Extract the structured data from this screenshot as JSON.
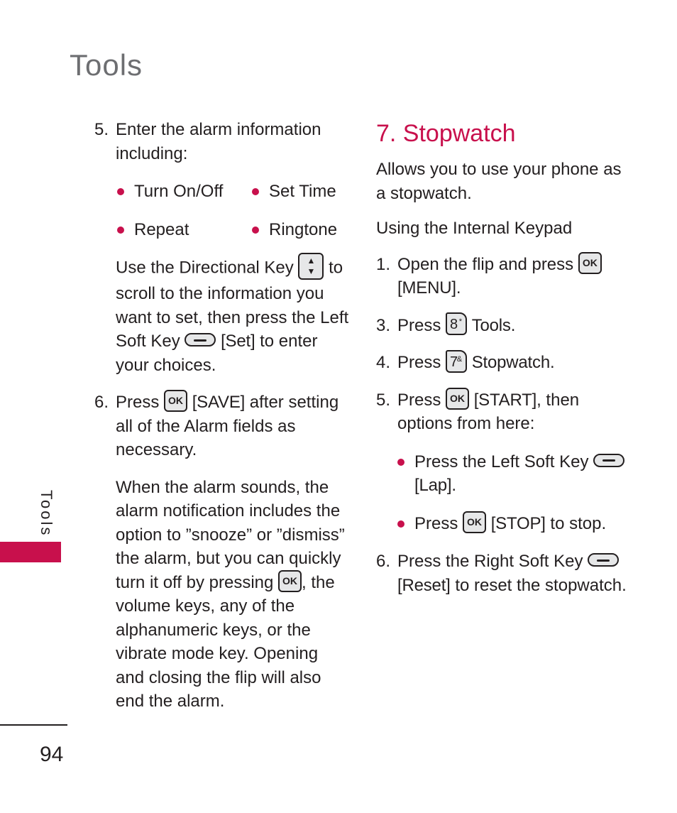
{
  "page": {
    "title": "Tools",
    "side_tab": "Tools",
    "page_number": "94",
    "accent_color": "#c8104c"
  },
  "left_column": {
    "step5": {
      "num": "5.",
      "text": "Enter the alarm information including:",
      "bullets": [
        "Turn On/Off",
        "Set Time",
        "Repeat",
        "Ringtone"
      ],
      "para_a": "Use the Directional Key",
      "para_b": "to scroll to the information you want to set, then press the Left Soft Key",
      "para_set": "[Set]",
      "para_c": "to enter your choices."
    },
    "step6": {
      "num": "6.",
      "text_a": "Press",
      "save": "[SAVE]",
      "text_b": "after setting all of the Alarm fields as necessary."
    },
    "alarm_note": {
      "text_a": "When the alarm sounds, the alarm notification includes the option to ”snooze” or ”dismiss” the alarm, but you can quickly turn it off by pressing",
      "text_b": ", the volume keys, any of the alphanumeric keys, or the vibrate mode key. Opening and closing the flip will also end the alarm."
    }
  },
  "right_column": {
    "section_title": "7. Stopwatch",
    "intro": "Allows you to use your phone as a stopwatch.",
    "subhead": "Using the Internal Keypad",
    "steps": [
      {
        "num": "1.",
        "text_a": "Open the flip and press",
        "bold": "[MENU]",
        "text_b": "."
      },
      {
        "num": "3.",
        "text_a": "Press",
        "key": "8",
        "key_sup": "*",
        "bold": "Tools",
        "text_b": "."
      },
      {
        "num": "4.",
        "text_a": "Press",
        "key": "7",
        "key_sup": "&",
        "bold": "Stopwatch",
        "text_b": "."
      },
      {
        "num": "5.",
        "text_a": "Press",
        "bold": "[START]",
        "text_b": ", then options from here:"
      },
      {
        "num": "6.",
        "text_a": "Press the Right Soft Key",
        "bold": "[Reset]",
        "text_b": "to reset the stopwatch."
      }
    ],
    "sub_bullets": [
      {
        "text_a": "Press the Left Soft Key",
        "bold": "[Lap]",
        "text_b": "."
      },
      {
        "text_a": "Press",
        "bold": "[STOP]",
        "text_b": "to stop."
      }
    ]
  },
  "icons": {
    "ok_label": "OK",
    "dir_up": "▲",
    "dir_down": "▼"
  }
}
